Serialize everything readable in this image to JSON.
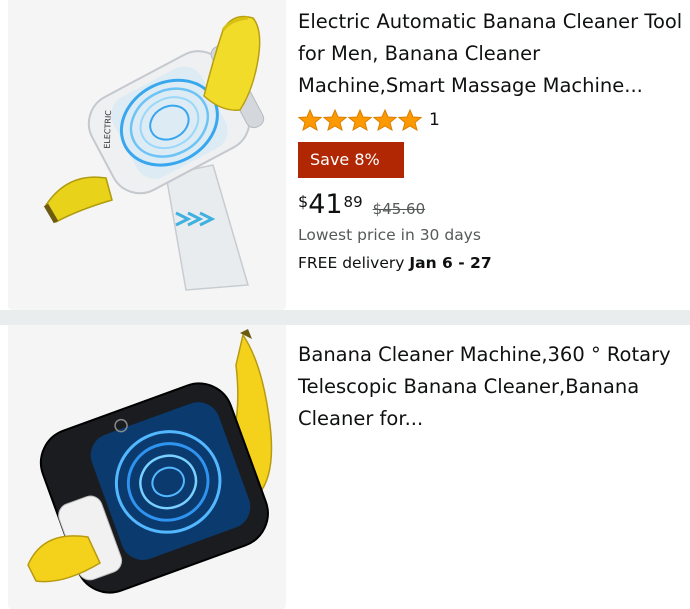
{
  "products": [
    {
      "title": "Electric Automatic Banana Cleaner Tool for Men, Banana Cleaner Machine,Smart Massage Machine...",
      "rating_stars": 5,
      "rating_count": "1",
      "save_badge": "Save 8%",
      "price_symbol": "$",
      "price_whole": "41",
      "price_fraction": "89",
      "list_price": "$45.60",
      "lowest_price_note": "Lowest price in 30 days",
      "delivery_label": "FREE delivery",
      "delivery_dates": "Jan 6 - 27",
      "image_icon": "banana-cleaner-cylinder-image",
      "device_brand_text": "ELECTRIC"
    },
    {
      "title": "Banana Cleaner Machine,360 ° Rotary Telescopic Banana Cleaner,Banana Cleaner for...",
      "image_icon": "banana-cleaner-box-image"
    }
  ],
  "colors": {
    "badge": "#b12704",
    "star": "#ff9900",
    "separator": "#eaeded",
    "muted": "#565959"
  }
}
